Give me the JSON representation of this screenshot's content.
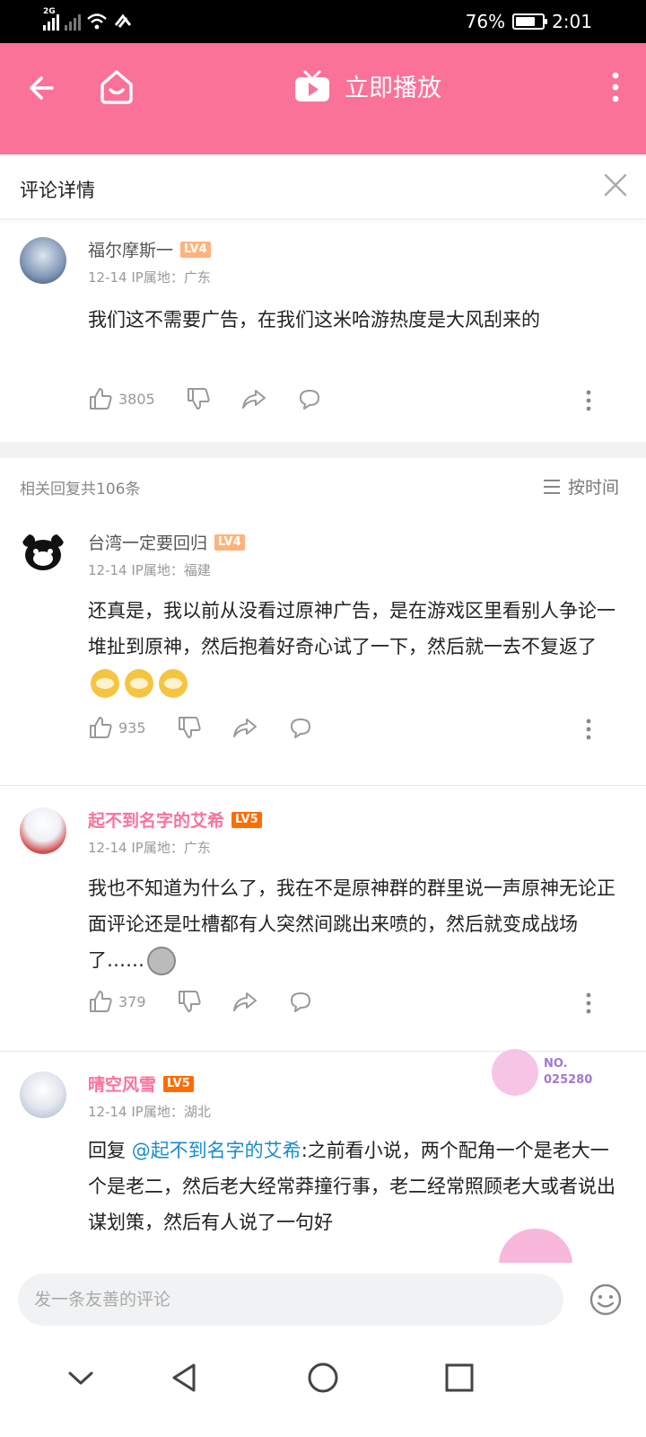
{
  "status_bar": {
    "network": "2G",
    "battery_percent": "76%",
    "battery_level": 0.76,
    "time": "2:01"
  },
  "app_bar": {
    "play_label": "立即播放",
    "accent_color": "#fb7299"
  },
  "sheet": {
    "title": "评论详情"
  },
  "main_comment": {
    "username": "福尔摩斯一",
    "level": "LV4",
    "meta": "12-14  IP属地：广东",
    "text": "我们这不需要广告，在我们这米哈游热度是大风刮来的",
    "likes": "3805"
  },
  "replies_header": {
    "count_label": "相关回复共106条",
    "sort_label": "按时间"
  },
  "replies": [
    {
      "username": "台湾一定要回归",
      "level": "LV4",
      "meta": "12-14  IP属地：福建",
      "text": "还真是，我以前从没看过原神广告，是在游戏区里看别人争论一堆扯到原神，然后抱着好奇心试了一下，然后就一去不复返了",
      "likes": "935"
    },
    {
      "username": "起不到名字的艾希",
      "level": "LV5",
      "meta": "12-14  IP属地：广东",
      "text": "我也不知道为什么了，我在不是原神群的群里说一声原神无论正面评论还是吐槽都有人突然间跳出来喷的，然后就变成战场了……",
      "likes": "379"
    },
    {
      "username": "晴空风雪",
      "level": "LV5",
      "meta": "12-14  IP属地：湖北",
      "reply_prefix": "回复 ",
      "mention": "@起不到名字的艾希",
      "text": ":之前看小说，两个配角一个是老大一个是老二，然后老大经常莽撞行事，老二经常照顾老大或者说出谋划策，然后有人说了一句好",
      "badge_no_label": "NO.",
      "badge_no_value": "025280"
    }
  ],
  "input_bar": {
    "placeholder": "发一条友善的评论"
  }
}
